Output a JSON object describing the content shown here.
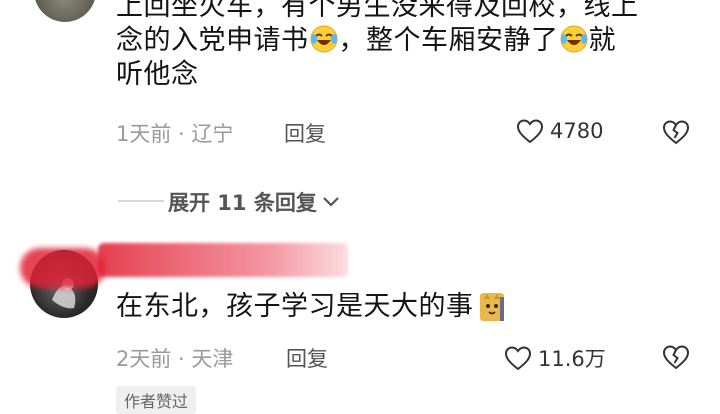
{
  "comment1": {
    "line1": "上回坐火车，有个男生没来得及回校，线上",
    "line2a": "念的入党申请书",
    "line2b": "，整个车厢安静了",
    "line2c": "就",
    "line3": "听他念",
    "time_location": "1天前 · 辽宁",
    "reply_label": "回复",
    "likes": "4780"
  },
  "expand_replies": {
    "label": "展开 11 条回复"
  },
  "comment2": {
    "text": "在东北，孩子学习是天大的事",
    "time_location": "2天前 · 天津",
    "reply_label": "回复",
    "likes": "11.6万",
    "badge": "作者赞过"
  },
  "icons": {
    "heart": "heart-outline-icon",
    "dislike": "broken-heart-icon",
    "chevron": "chevron-down-icon",
    "emoji": "laughing-tears-emoji",
    "sticker": "cat-sticker"
  }
}
